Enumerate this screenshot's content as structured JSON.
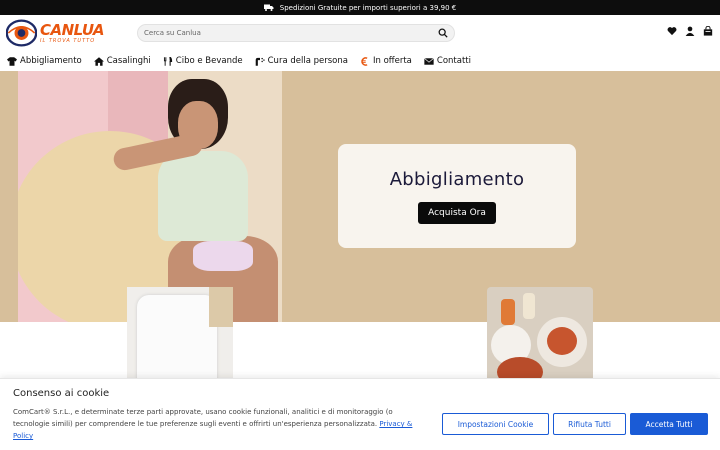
{
  "topbar": {
    "text": "Spedizioni Gratuite per importi superiori a 39,90 €",
    "icon": "truck-icon"
  },
  "logo": {
    "word": "CANLUA",
    "tagline": "IL TROVA TUTTO",
    "color": "#e8560f"
  },
  "search": {
    "placeholder": "Cerca su Canlua",
    "value": ""
  },
  "header_icons": [
    "heart-icon",
    "user-icon",
    "cart-icon"
  ],
  "nav": {
    "items": [
      {
        "label": "Abbigliamento",
        "icon": "shirt-icon"
      },
      {
        "label": "Casalinghi",
        "icon": "home-icon"
      },
      {
        "label": "Cibo e Bevande",
        "icon": "cutlery-icon"
      },
      {
        "label": "Cura della persona",
        "icon": "care-icon"
      },
      {
        "label": "In offerta",
        "icon": "euro-icon"
      },
      {
        "label": "Contatti",
        "icon": "envelope-icon"
      }
    ]
  },
  "hero": {
    "title": "Abbigliamento",
    "button": "Acquista Ora",
    "background": "#d7bf9b"
  },
  "cookie": {
    "title": "Consenso ai cookie",
    "text": "ComCart® S.r.L., e determinate terze parti approvate, usano cookie funzionali, analitici e di monitoraggio (o tecnologie simili) per comprendere le tue preferenze sugli eventi e offrirti un'esperienza personalizzata.",
    "link": "Privacy & Policy",
    "settings_button": "Impostazioni Cookie",
    "reject_button": "Rifiuta Tutti",
    "accept_button": "Accetta Tutti",
    "accent": "#1a5bd6"
  }
}
